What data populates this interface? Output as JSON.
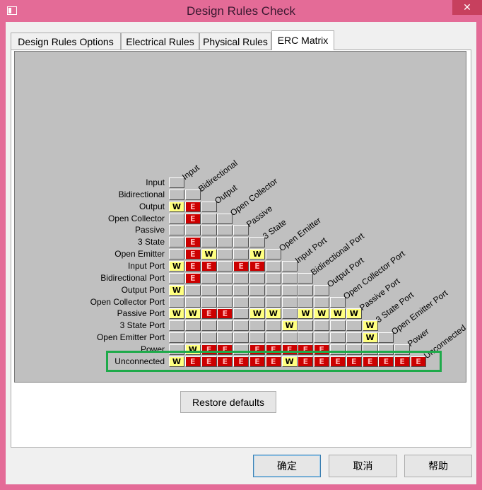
{
  "window": {
    "title": "Design Rules Check",
    "close_glyph": "✕"
  },
  "tabs": [
    {
      "label": "Design Rules Options"
    },
    {
      "label": "Electrical Rules"
    },
    {
      "label": "Physical Rules"
    },
    {
      "label": "ERC Matrix",
      "active": true
    }
  ],
  "matrix": {
    "row_labels": [
      "Input",
      "Bidirectional",
      "Output",
      "Open Collector",
      "Passive",
      "3 State",
      "Open Emitter",
      "Input Port",
      "Bidirectional Port",
      "Output Port",
      "Open Collector Port",
      "Passive Port",
      "3 State Port",
      "Open Emitter Port",
      "Power",
      "Unconnected"
    ],
    "col_labels": [
      "Input",
      "Bidirectional",
      "Output",
      "Open Collector",
      "Passive",
      "3 State",
      "Open Emitter",
      "Input Port",
      "Bidirectional Port",
      "Output Port",
      "Open Collector Port",
      "Passive Port",
      "3 State Port",
      "Open Emitter Port",
      "Power",
      "Unconnected"
    ],
    "rows": [
      [
        "-"
      ],
      [
        "-",
        "-"
      ],
      [
        "W",
        "E",
        "-"
      ],
      [
        "-",
        "E",
        "-",
        "-"
      ],
      [
        "-",
        "-",
        "-",
        "-",
        "-"
      ],
      [
        "-",
        "E",
        "-",
        "-",
        "-",
        "-"
      ],
      [
        "-",
        "E",
        "W",
        "-",
        "-",
        "W",
        "-"
      ],
      [
        "W",
        "E",
        "E",
        "-",
        "E",
        "E",
        "-",
        "-"
      ],
      [
        "-",
        "E",
        "-",
        "-",
        "-",
        "-",
        "-",
        "-",
        "-"
      ],
      [
        "W",
        "-",
        "-",
        "-",
        "-",
        "-",
        "-",
        "-",
        "-",
        "-"
      ],
      [
        "-",
        "-",
        "-",
        "-",
        "-",
        "-",
        "-",
        "-",
        "-",
        "-",
        "-"
      ],
      [
        "W",
        "W",
        "E",
        "E",
        "-",
        "W",
        "W",
        "-",
        "W",
        "W",
        "W",
        "W"
      ],
      [
        "-",
        "-",
        "-",
        "-",
        "-",
        "-",
        "-",
        "W",
        "-",
        "-",
        "-",
        "-",
        "W"
      ],
      [
        "-",
        "-",
        "-",
        "-",
        "-",
        "-",
        "-",
        "-",
        "-",
        "-",
        "-",
        "-",
        "W",
        "-"
      ],
      [
        "-",
        "W",
        "E",
        "E",
        "-",
        "E",
        "E",
        "E",
        "E",
        "E",
        "-",
        "-",
        "-",
        "-",
        "-"
      ],
      [
        "W",
        "E",
        "E",
        "E",
        "E",
        "E",
        "E",
        "W",
        "E",
        "E",
        "E",
        "E",
        "E",
        "E",
        "E",
        "E"
      ]
    ],
    "legend_marks": {
      "warning": "W",
      "error": "E"
    }
  },
  "buttons": {
    "restore": "Restore defaults",
    "ok": "确定",
    "cancel": "取消",
    "help": "帮助"
  },
  "colors": {
    "title_bar": "#e46b97",
    "warning": "#ffff80",
    "error": "#cc0000",
    "no_report": "#c0c0c0",
    "highlight": "#1eaa4a"
  }
}
